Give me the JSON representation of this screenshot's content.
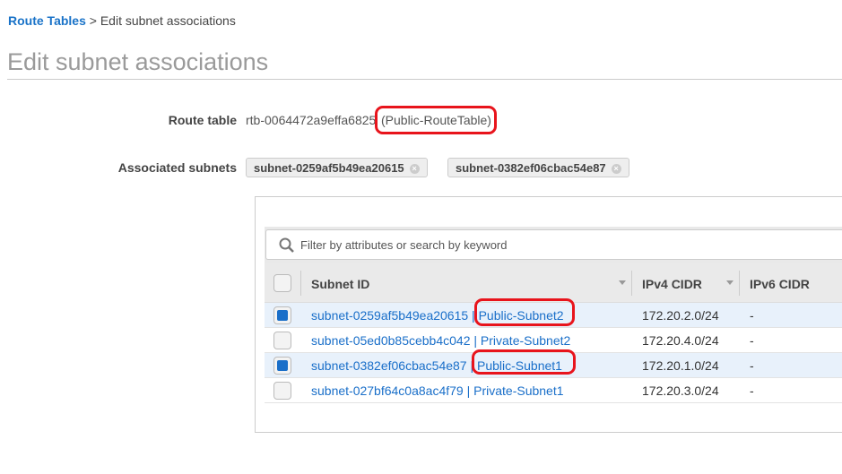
{
  "breadcrumb": {
    "link": "Route Tables",
    "separator": ">",
    "current": "Edit subnet associations"
  },
  "page_title": "Edit subnet associations",
  "route_table": {
    "label": "Route table",
    "id": "rtb-0064472a9effa6825",
    "name": "(Public-RouteTable)"
  },
  "associated": {
    "label": "Associated subnets",
    "chips": [
      "subnet-0259af5b49ea20615",
      "subnet-0382ef06cbac54e87"
    ]
  },
  "search": {
    "placeholder": "Filter by attributes or search by keyword"
  },
  "table": {
    "headers": [
      "Subnet ID",
      "IPv4 CIDR",
      "IPv6 CIDR"
    ],
    "rows": [
      {
        "id": "subnet-0259af5b49ea20615 |",
        "name": "Public-Subnet2",
        "ipv4": "172.20.2.0/24",
        "ipv6": "-",
        "checked": true
      },
      {
        "id": "subnet-05ed0b85cebb4c042 |",
        "name": "Private-Subnet2",
        "ipv4": "172.20.4.0/24",
        "ipv6": "-",
        "checked": false
      },
      {
        "id": "subnet-0382ef06cbac54e87 |",
        "name": "Public-Subnet1",
        "ipv4": "172.20.1.0/24",
        "ipv6": "-",
        "checked": true
      },
      {
        "id": "subnet-027bf64c0a8ac4f79 |",
        "name": "Private-Subnet1",
        "ipv4": "172.20.3.0/24",
        "ipv6": "-",
        "checked": false
      }
    ]
  },
  "colors": {
    "link": "#1a6fc9",
    "highlight": "#e8141c",
    "selected_row": "#e8f1fb"
  }
}
